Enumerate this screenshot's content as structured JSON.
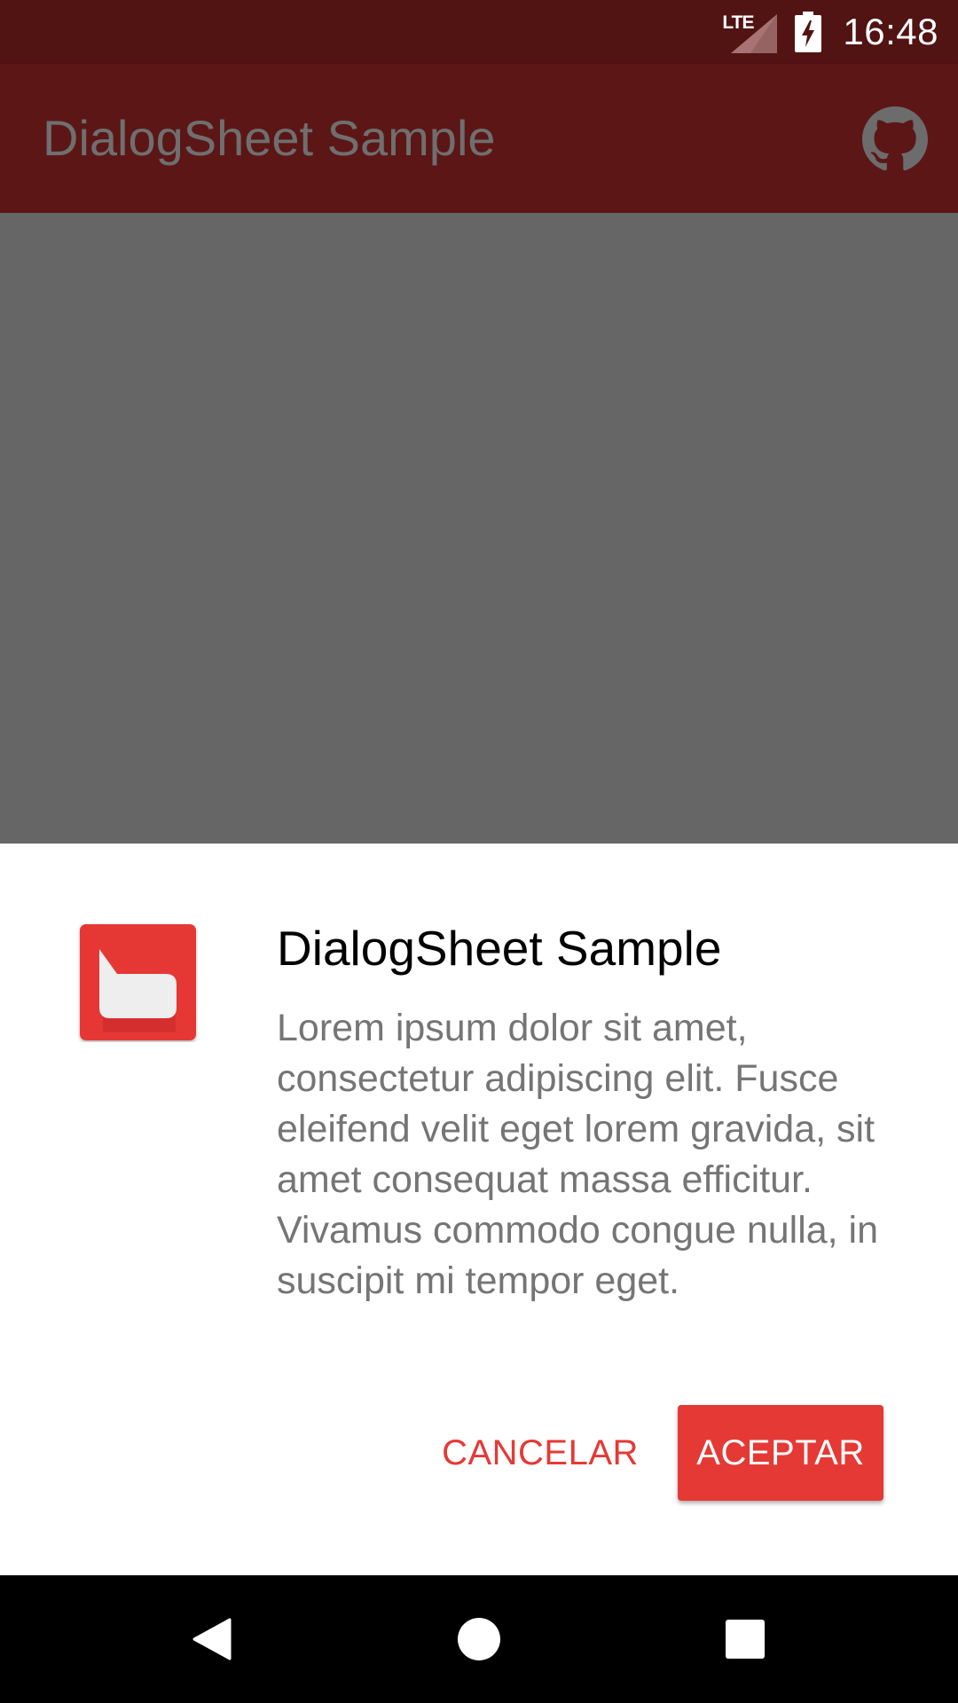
{
  "status_bar": {
    "network_label": "LTE",
    "time": "16:48",
    "icons": [
      "lte-signal-icon",
      "battery-charging-icon"
    ]
  },
  "app_bar": {
    "title": "DialogSheet Sample",
    "action_icon": "github-icon"
  },
  "dialog": {
    "icon": "chat-bubble-icon",
    "title": "DialogSheet Sample",
    "message": "Lorem ipsum dolor sit amet, consectetur adipiscing elit. Fusce eleifend velit eget lorem gravida, sit amet consequat massa efficitur. Vivamus commodo congue nulla, in suscipit mi tempor eget.",
    "negative_label": "CANCELAR",
    "positive_label": "ACEPTAR"
  },
  "nav_bar": {
    "icons": [
      "back-icon",
      "home-icon",
      "recents-icon"
    ]
  },
  "colors": {
    "status_bar": "#521313",
    "app_bar": "#5c1616",
    "scrim": "#666666",
    "accent": "#e53935",
    "sheet_background": "#ffffff",
    "message_text": "#757575"
  }
}
